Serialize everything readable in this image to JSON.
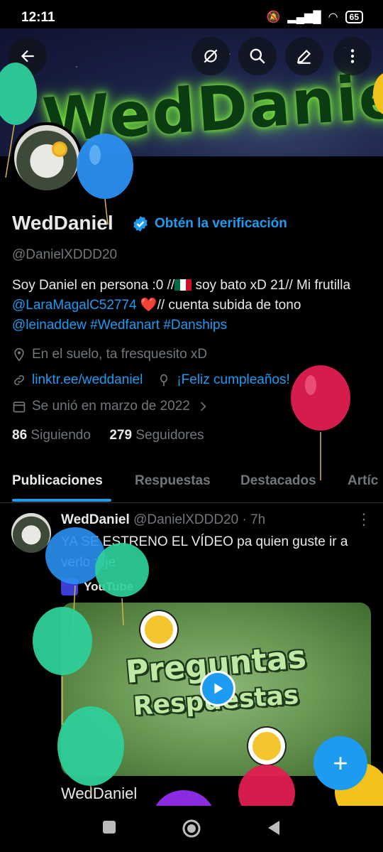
{
  "status_bar": {
    "time": "12:11",
    "battery": "65"
  },
  "banner": {
    "text": "WedDaniel"
  },
  "profile": {
    "name": "WedDaniel",
    "get_verified": "Obtén la verificación",
    "handle": "@DanielXDDD20",
    "bio": {
      "p1": "Soy Daniel en persona :0 //",
      "p2": " soy bato xD 21// Mi frutilla ",
      "mention1": "@LaraMagalC52774",
      "heart": " ❤️",
      "p3": "// cuenta subida de tono ",
      "mention2": "@leinaddew",
      "hashtag1": "#Wedfanart",
      "hashtag2": "#Danships"
    },
    "location": "En el suelo, ta fresquesito xD",
    "website": "linktr.ee/weddaniel",
    "birthday": "¡Feliz cumpleaños!",
    "joined": "Se unió en marzo de 2022",
    "following_count": "86",
    "following_label": "Siguiendo",
    "followers_count": "279",
    "followers_label": "Seguidores"
  },
  "tabs": [
    {
      "label": "Publicaciones"
    },
    {
      "label": "Respuestas"
    },
    {
      "label": "Destacados"
    },
    {
      "label": "Artíc"
    }
  ],
  "post": {
    "author": "WedDaniel",
    "handle": "@DanielXDDD20",
    "time": "· 7h",
    "text": "YA SE ESTRENO EL VÍDEO pa quien guste ir a verlo :eje",
    "source": "YouTube",
    "video_title_1": "Preguntas",
    "video_title_2": "Respuestas",
    "author_footer": "WedDaniel"
  },
  "colors": {
    "accent": "#1d9bf0",
    "muted": "#71767b",
    "text": "#e7e9ea"
  },
  "icons": [
    "back-arrow-icon",
    "sync-off-icon",
    "search-icon",
    "edit-icon",
    "more-vertical-icon",
    "verified-badge-icon",
    "location-icon",
    "link-icon",
    "balloon-icon",
    "calendar-icon",
    "chevron-right-icon",
    "more-horizontal-icon",
    "play-icon",
    "plus-icon",
    "square-nav-icon",
    "circle-nav-icon",
    "triangle-nav-icon"
  ]
}
